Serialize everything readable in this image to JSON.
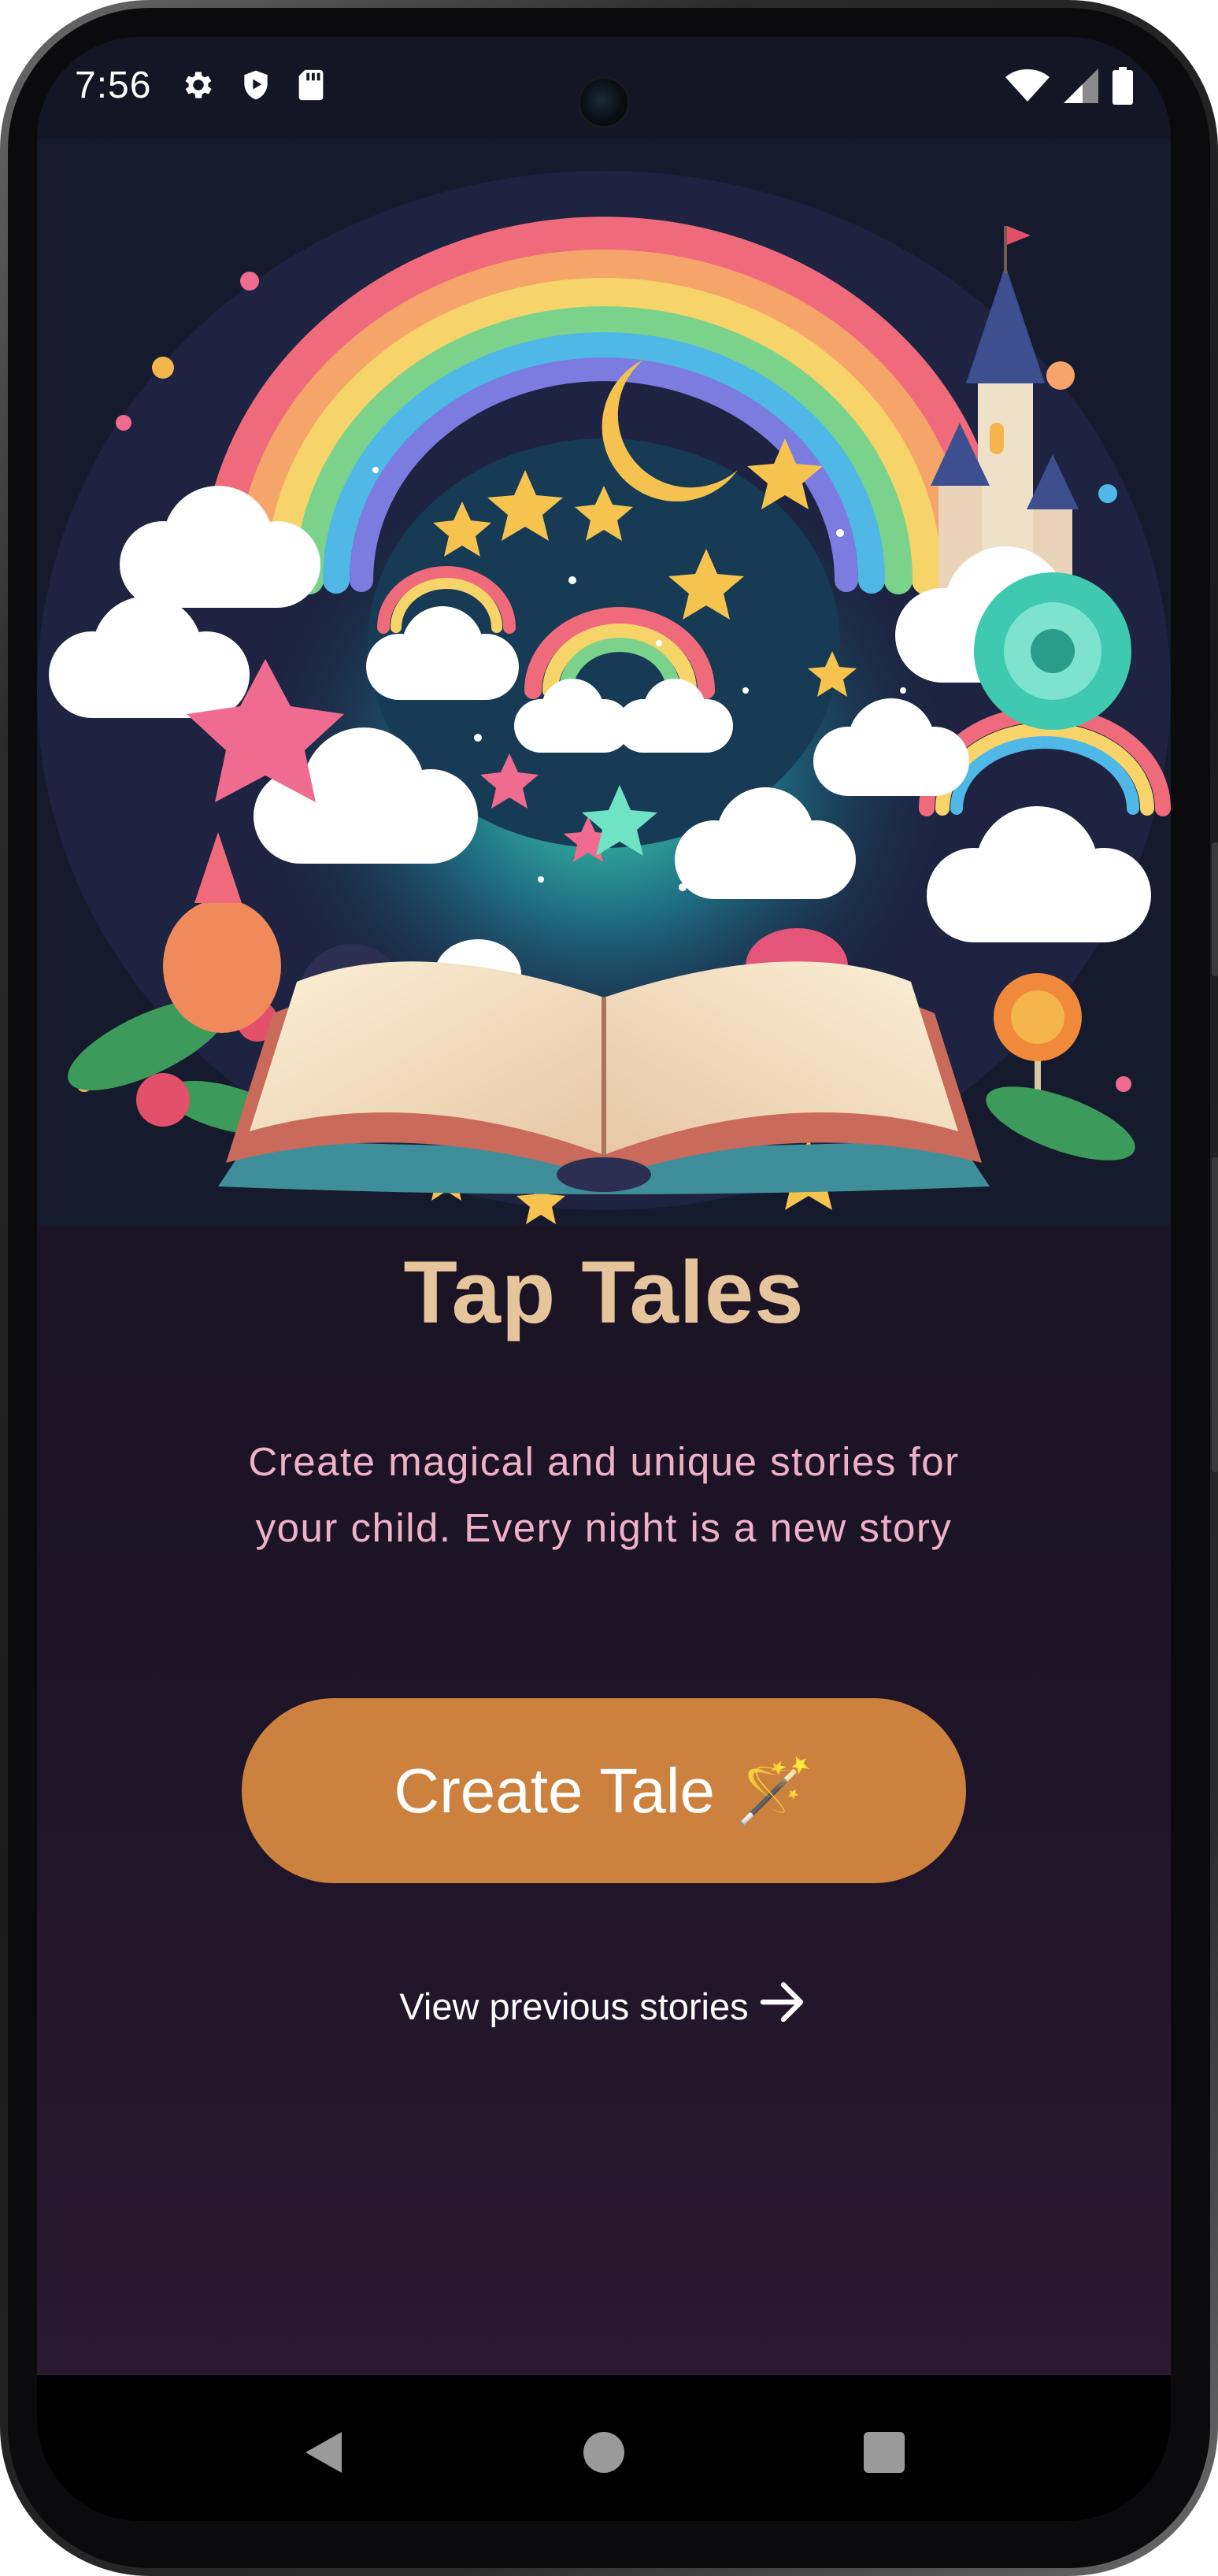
{
  "status_bar": {
    "time": "7:56",
    "left_icons": [
      "gear-icon",
      "shield-play-icon",
      "sd-card-icon"
    ],
    "right_icons": [
      "wifi-icon",
      "cellular-signal-icon",
      "battery-icon"
    ]
  },
  "hero": {
    "description_icon": "storybook-illustration"
  },
  "main": {
    "title": "Tap Tales",
    "subtitle": "Create magical and unique stories for your child. Every night is a new story",
    "create_button_label": "Create Tale",
    "create_button_emoji": "🪄",
    "view_previous_label": "View previous stories",
    "view_previous_icon": "arrow-right-icon"
  },
  "nav_bar": {
    "buttons": [
      "back-icon",
      "home-icon",
      "recents-icon"
    ]
  },
  "colors": {
    "title": "#e6c49c",
    "subtitle": "#efb0c8",
    "button": "#cd813e",
    "background_top": "#141626",
    "background_bottom": "#2d1a32"
  }
}
